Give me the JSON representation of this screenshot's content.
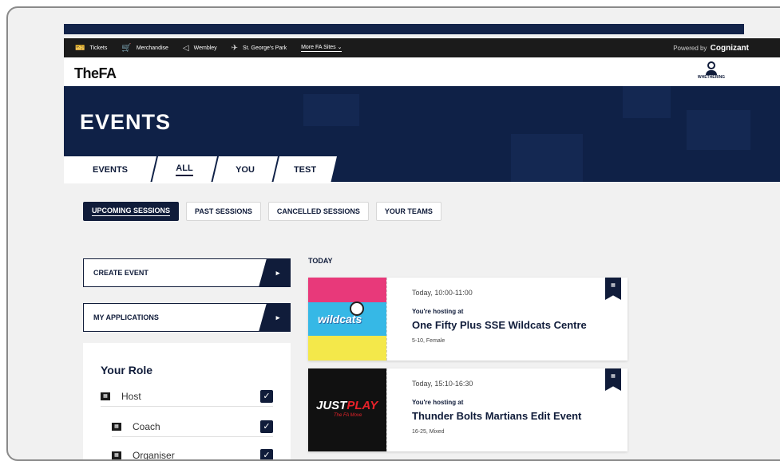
{
  "sitenav": {
    "items": [
      {
        "label": "Tickets",
        "icon": "ticket-icon",
        "glyph": "🎫"
      },
      {
        "label": "Merchandise",
        "icon": "cart-icon",
        "glyph": "🛒"
      },
      {
        "label": "Wembley",
        "icon": "wembley-icon",
        "glyph": "◁"
      },
      {
        "label": "St. George's Park",
        "icon": "plane-icon",
        "glyph": "✈"
      }
    ],
    "more": "More FA Sites ⌄",
    "powered_by": "Powered by",
    "powered_brand": "Cognizant"
  },
  "brand": {
    "logo": "TheFA"
  },
  "user": {
    "name": "WHETHERING"
  },
  "hero": {
    "title": "EVENTS"
  },
  "tabs": [
    "EVENTS",
    "ALL",
    "YOU",
    "TEST"
  ],
  "subtabs": [
    "UPCOMING SESSIONS",
    "PAST SESSIONS",
    "CANCELLED SESSIONS",
    "YOUR TEAMS"
  ],
  "actions": {
    "create": "CREATE EVENT",
    "applications": "MY APPLICATIONS",
    "arrow": "▸"
  },
  "role": {
    "title": "Your Role",
    "items": [
      {
        "label": "Host",
        "checked": "✓"
      },
      {
        "label": "Coach",
        "checked": "✓"
      },
      {
        "label": "Organiser",
        "checked": "✓"
      }
    ]
  },
  "events": {
    "heading": "TODAY",
    "items": [
      {
        "time": "Today, 10:00-11:00",
        "hosting": "You're hosting at",
        "name": "One Fifty Plus SSE Wildcats Centre",
        "meta": "5-10, Female",
        "logo_text": "wildcats"
      },
      {
        "time": "Today, 15:10-16:30",
        "hosting": "You're hosting at",
        "name": "Thunder Bolts Martians Edit Event",
        "meta": "16-25, Mixed",
        "logo_text": "JUST",
        "logo_text2": "PLAY",
        "logo_sub": "The FA Move"
      }
    ]
  },
  "colors": {
    "navy": "#0f2147",
    "accent": "#101c3a"
  }
}
